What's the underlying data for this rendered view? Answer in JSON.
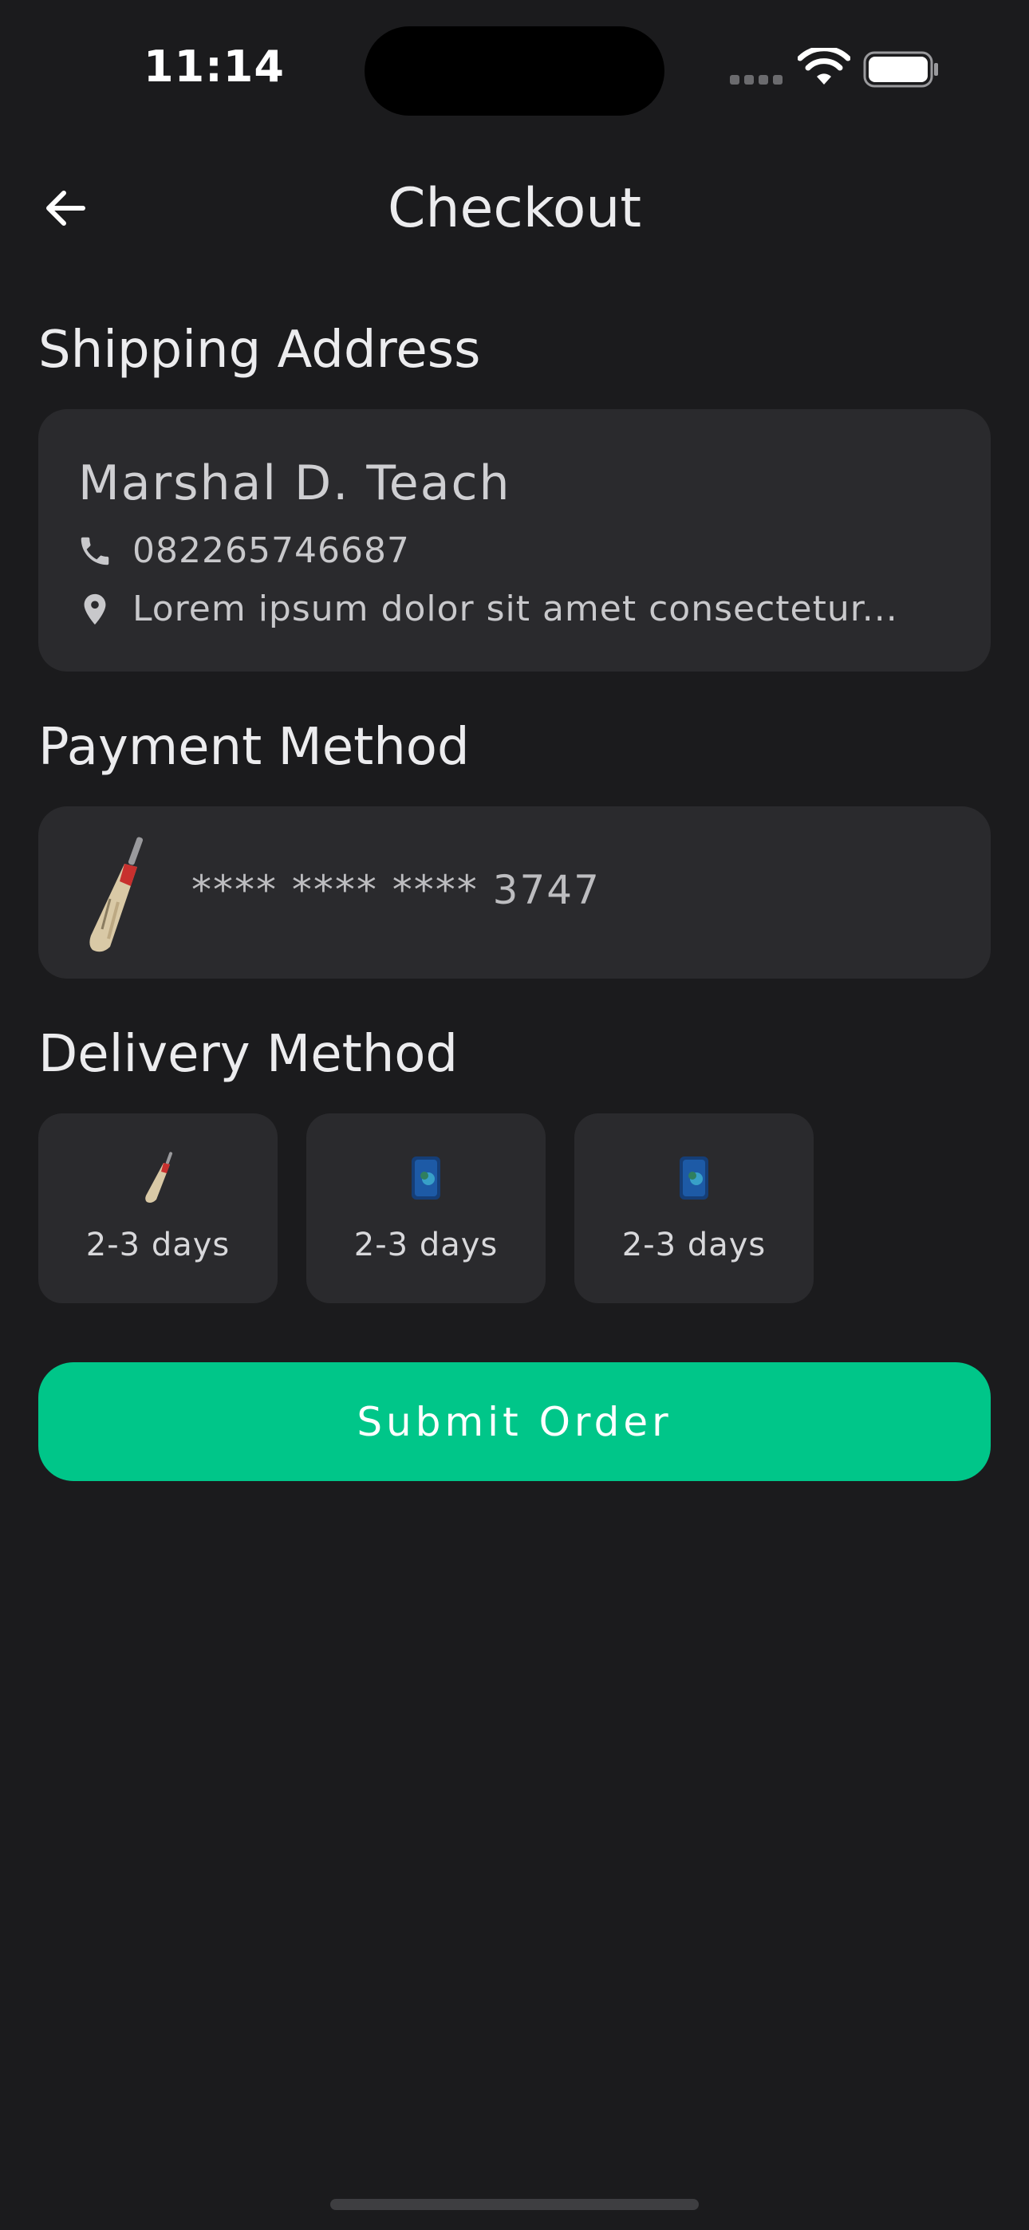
{
  "status_bar": {
    "time": "11:14"
  },
  "header": {
    "title": "Checkout",
    "back_icon": "arrow-left-icon"
  },
  "shipping": {
    "section_title": "Shipping Address",
    "name": "Marshal D. Teach",
    "phone": "082265746687",
    "address": "Lorem ipsum dolor sit amet consectetur..."
  },
  "payment": {
    "section_title": "Payment Method",
    "card_number": "**** **** **** 3747",
    "image": "cricket-bat"
  },
  "delivery": {
    "section_title": "Delivery Method",
    "options": [
      {
        "label": "2-3 days",
        "image": "cricket-bat"
      },
      {
        "label": "2-3 days",
        "image": "phone"
      },
      {
        "label": "2-3 days",
        "image": "phone"
      }
    ]
  },
  "actions": {
    "submit_label": "Submit Order"
  },
  "colors": {
    "background": "#1b1b1d",
    "card": "#2a2a2d",
    "accent": "#00c689"
  }
}
